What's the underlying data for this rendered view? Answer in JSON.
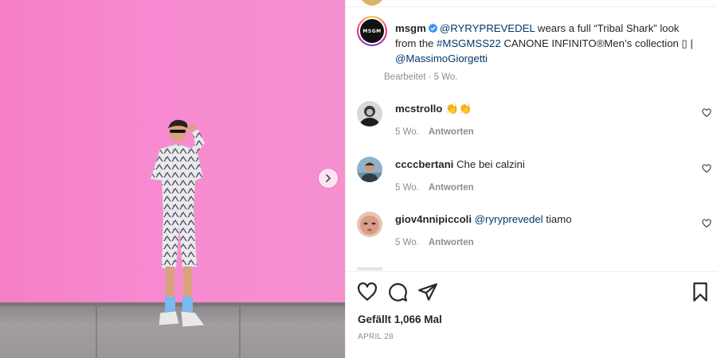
{
  "post": {
    "brand_logo_text": "MSGM",
    "username": "msgm",
    "verified_icon": "verified-badge-icon",
    "caption_mention": "@RYRYPREVEDEL",
    "caption_part1": " wears a full “Tribal Shark” look from the ",
    "caption_hashtag": "#MSGMSS22",
    "caption_part2": " CANONE INFINITO®Men’s collection \u0000 | ",
    "caption_mention2": "@MassimoGiorgetti",
    "caption_box_glyph": "▯",
    "edited_meta": "Bearbeitet · 5 Wo."
  },
  "comments": [
    {
      "username": "mcstrollo",
      "text": "",
      "emoji": "👏👏",
      "time": "5 Wo.",
      "reply_label": "Antworten"
    },
    {
      "username": "ccccbertani",
      "text": "Che bei calzini",
      "time": "5 Wo.",
      "reply_label": "Antworten"
    },
    {
      "username": "giov4nnipiccoli",
      "mention": "@ryryprevedel",
      "text": " tiamo",
      "time": "5 Wo.",
      "reply_label": "Antworten"
    }
  ],
  "actions": {
    "like_icon": "heart-icon",
    "comment_icon": "comment-icon",
    "share_icon": "paper-plane-icon",
    "save_icon": "bookmark-icon"
  },
  "likes_text": "Gefällt 1,066 Mal",
  "date_text": "APRIL 28",
  "colors": {
    "photo_background": "#f78ad0",
    "link": "#00376b",
    "muted": "#8e8e8e"
  }
}
